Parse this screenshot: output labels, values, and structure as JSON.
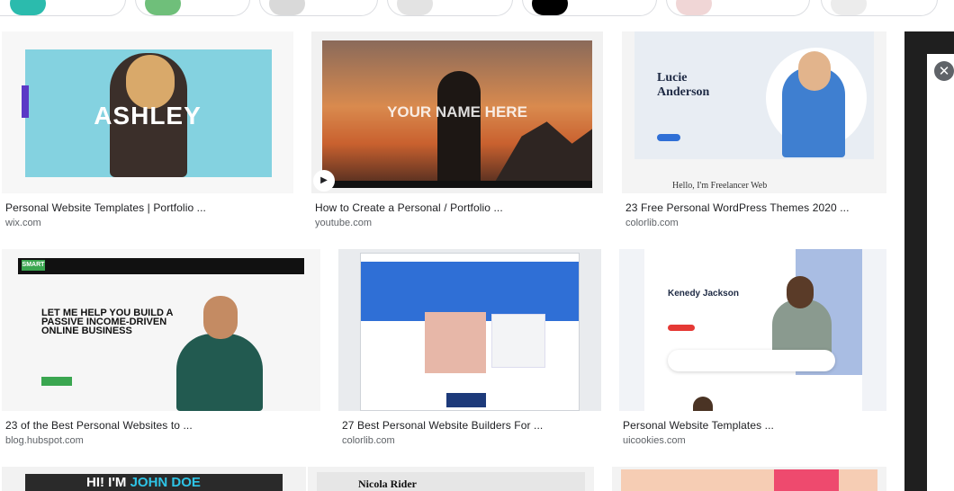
{
  "results": [
    {
      "title": "Personal Website Templates | Portfolio ...",
      "source": "wix.com",
      "thumb_text": "ASHLEY"
    },
    {
      "title": "How to Create a Personal / Portfolio ...",
      "source": "youtube.com",
      "thumb_text": "YOUR NAME HERE"
    },
    {
      "title": "23 Free Personal WordPress Themes 2020 ...",
      "source": "colorlib.com",
      "thumb_text": "Lucie Anderson",
      "thumb_subtext": "Hello, I'm Freelancer Web"
    },
    {
      "title": "23 of the Best Personal Websites to ...",
      "source": "blog.hubspot.com",
      "thumb_text": "LET ME HELP YOU BUILD A PASSIVE INCOME-DRIVEN ONLINE BUSINESS",
      "thumb_logo": "SMART"
    },
    {
      "title": "27 Best Personal Website Builders For ...",
      "source": "colorlib.com"
    },
    {
      "title": "Personal Website Templates ...",
      "source": "uicookies.com",
      "thumb_text": "Kenedy Jackson"
    },
    {
      "thumb_text_a": "HI! I'M",
      "thumb_text_b": "JOHN DOE"
    },
    {
      "thumb_text": "Nicola Rider"
    },
    {}
  ],
  "colors": {
    "title": "#202124",
    "source": "#5f6368",
    "panel": "#1f1f1f",
    "accent_blue": "#2f6fd6",
    "cyan": "#84d2e0"
  },
  "icons": {
    "close": "close-icon",
    "play": "play-icon"
  }
}
